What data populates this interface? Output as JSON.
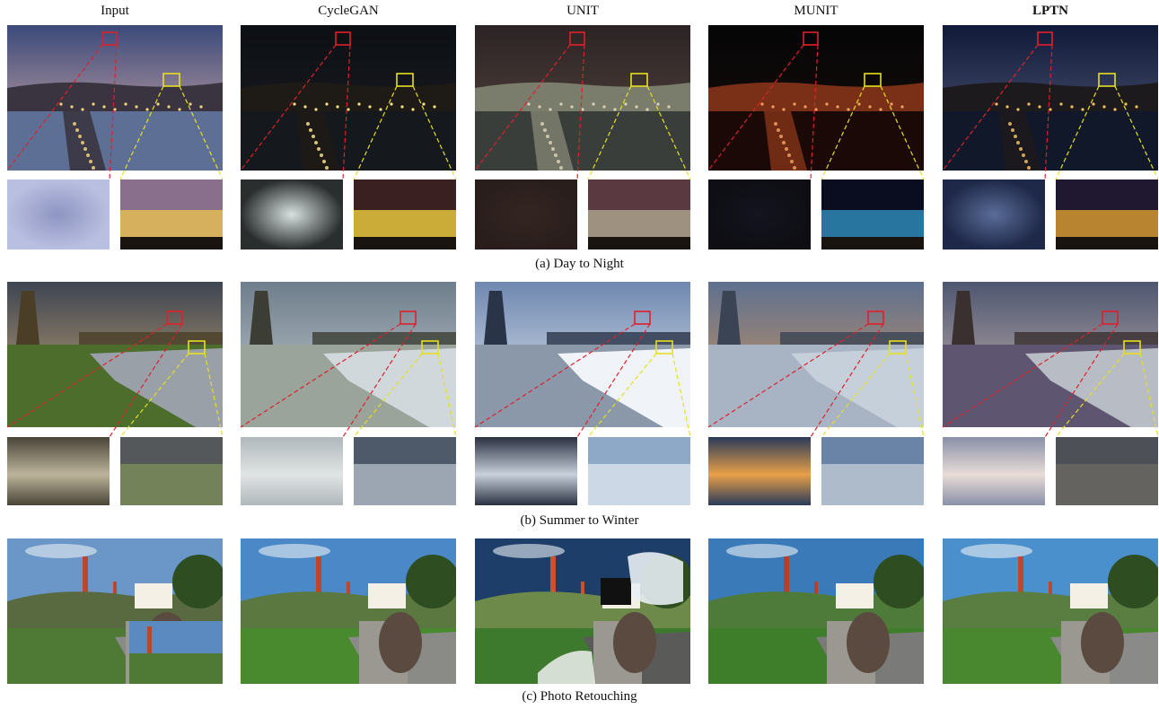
{
  "columns": [
    "Input",
    "CycleGAN",
    "UNIT",
    "MUNIT",
    "LPTN"
  ],
  "bold_column": "LPTN",
  "rows": [
    {
      "id": "day-to-night",
      "caption": "(a) Day to Night"
    },
    {
      "id": "summer-to-winter",
      "caption": "(b) Summer to Winter"
    },
    {
      "id": "photo-retouching",
      "caption": "(c) Photo Retouching"
    }
  ],
  "colors": {
    "highlight_red": "#e0202a",
    "highlight_yellow": "#e6e020"
  }
}
